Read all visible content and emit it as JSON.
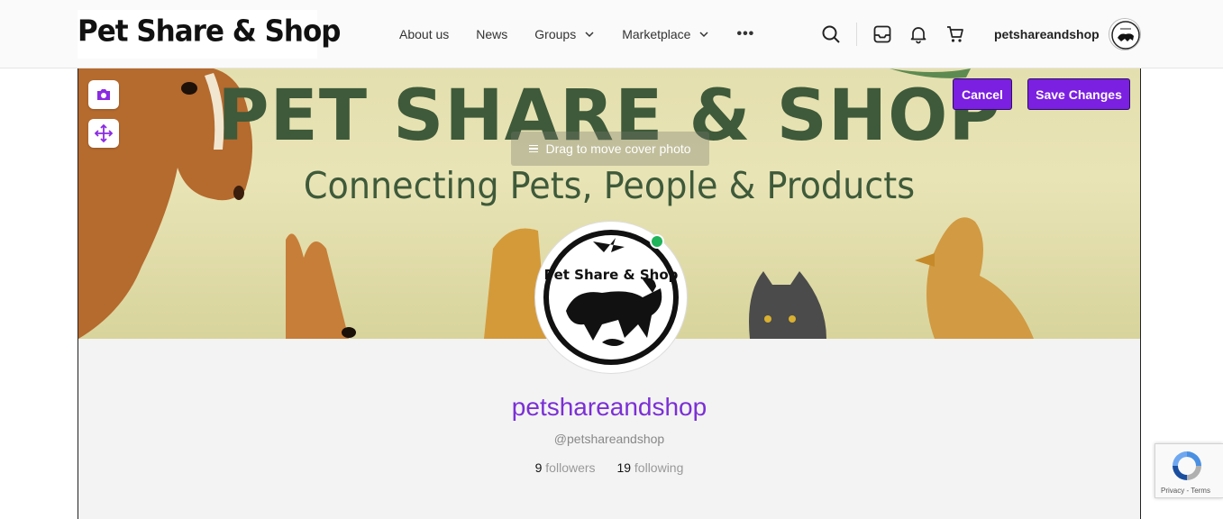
{
  "header": {
    "logo_text": "Pet Share & Shop",
    "nav": [
      {
        "label": "About us",
        "has_dropdown": false
      },
      {
        "label": "News",
        "has_dropdown": false
      },
      {
        "label": "Groups",
        "has_dropdown": true
      },
      {
        "label": "Marketplace",
        "has_dropdown": true
      }
    ],
    "more_label": "•••",
    "icons": [
      "search-icon",
      "inbox-icon",
      "bell-icon",
      "cart-icon"
    ],
    "username": "petshareandshop"
  },
  "cover": {
    "title": "PET SHARE & SHOP",
    "subtitle": "Connecting Pets, People & Products",
    "drag_hint": "Drag to move cover photo",
    "cancel_label": "Cancel",
    "save_label": "Save Changes"
  },
  "avatar": {
    "logo_text": "Pet Share & Shop"
  },
  "profile": {
    "display_name": "petshareandshop",
    "handle": "@petshareandshop",
    "followers_count": "9",
    "followers_label": "followers",
    "following_count": "19",
    "following_label": "following",
    "online": true
  },
  "recaptcha": {
    "text": "Privacy - Terms"
  },
  "colors": {
    "accent": "#7b1fe0",
    "name": "#7b2fd6",
    "online": "#1fb35a",
    "cover_text": "#3e5a3a"
  }
}
